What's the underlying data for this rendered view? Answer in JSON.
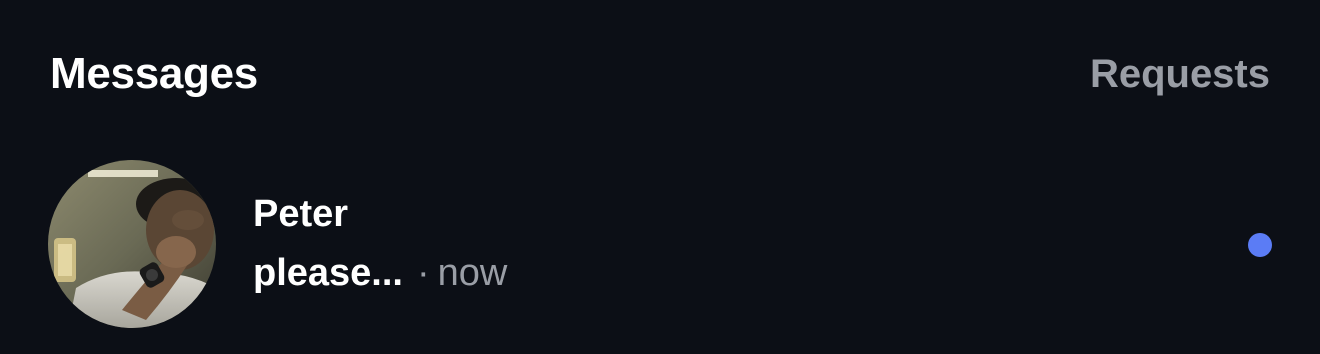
{
  "header": {
    "title": "Messages",
    "requests_label": "Requests"
  },
  "conversation": {
    "name": "Peter",
    "preview": "please...",
    "separator": "·",
    "time": "now",
    "unread": true,
    "avatar_icon": "profile-photo"
  },
  "colors": {
    "background": "#0c0f16",
    "primary_text": "#ffffff",
    "secondary_text": "#9a9ea6",
    "unread_dot": "#5b7cf5"
  }
}
